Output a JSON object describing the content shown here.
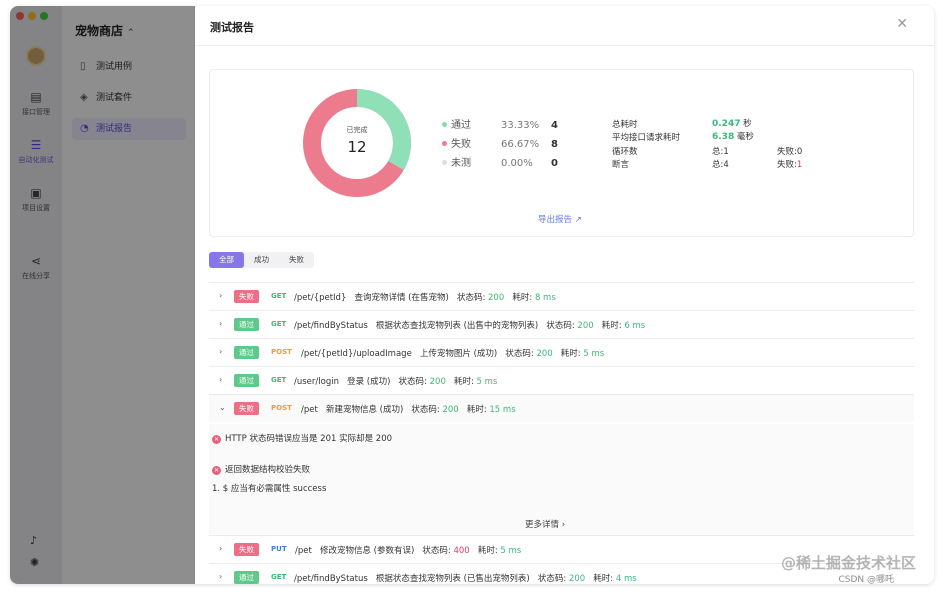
{
  "sidebar": {
    "items": [
      {
        "label": "接口管理",
        "icon": "api-icon"
      },
      {
        "label": "自动化测试",
        "icon": "stack-icon",
        "active": true
      },
      {
        "label": "项目设置",
        "icon": "settings-icon"
      },
      {
        "label": "在线分享",
        "icon": "share-icon"
      }
    ]
  },
  "project": {
    "title": "宠物商店",
    "nav": [
      {
        "label": "测试用例",
        "icon": "file-icon"
      },
      {
        "label": "测试套件",
        "icon": "suite-icon"
      },
      {
        "label": "测试报告",
        "icon": "report-icon",
        "active": true
      }
    ]
  },
  "modal": {
    "title": "测试报告",
    "close": "✕"
  },
  "summary": {
    "center_label": "已完成",
    "center_value": "12",
    "legend": [
      {
        "name": "通过",
        "pct": "33.33%",
        "count": "4",
        "color": "#7edcae"
      },
      {
        "name": "失败",
        "pct": "66.67%",
        "count": "8",
        "color": "#ec7b8e"
      },
      {
        "name": "未测",
        "pct": "0.00%",
        "count": "0",
        "color": "#dddddd"
      }
    ],
    "stats": {
      "total_time_label": "总耗时",
      "total_time_value": "0.247",
      "total_time_unit": "秒",
      "avg_label": "平均接口请求耗时",
      "avg_value": "6.38",
      "avg_unit": "毫秒",
      "loop_label": "循环数",
      "loop_total": "总:1",
      "loop_fail": "失败:0",
      "assert_label": "断言",
      "assert_total": "总:4",
      "assert_fail_prefix": "失败:",
      "assert_fail_value": "1"
    },
    "export": "导出报告 ↗",
    "donut": {
      "pass": 4,
      "fail": 8,
      "untested": 0,
      "pass_color": "#8fe0b6",
      "fail_color": "#ec7b8e"
    }
  },
  "filters": [
    "全部",
    "成功",
    "失败"
  ],
  "rows": [
    {
      "status": "失败",
      "method": "GET",
      "path": "/pet/{petId}",
      "desc": "查询宠物详情 (在售宠物)",
      "code_label": "状态码:",
      "code": "200",
      "time_label": "耗时:",
      "time": "8 ms"
    },
    {
      "status": "通过",
      "method": "GET",
      "path": "/pet/findByStatus",
      "desc": "根据状态查找宠物列表 (出售中的宠物列表)",
      "code_label": "状态码:",
      "code": "200",
      "time_label": "耗时:",
      "time": "6 ms"
    },
    {
      "status": "通过",
      "method": "POST",
      "path": "/pet/{petId}/uploadImage",
      "desc": "上传宠物图片 (成功)",
      "code_label": "状态码:",
      "code": "200",
      "time_label": "耗时:",
      "time": "5 ms"
    },
    {
      "status": "通过",
      "method": "GET",
      "path": "/user/login",
      "desc": "登录 (成功)",
      "code_label": "状态码:",
      "code": "200",
      "time_label": "耗时:",
      "time": "5 ms"
    },
    {
      "status": "失败",
      "method": "POST",
      "path": "/pet",
      "desc": "新建宠物信息 (成功)",
      "code_label": "状态码:",
      "code": "200",
      "time_label": "耗时:",
      "time": "15 ms"
    },
    {
      "status": "失败",
      "method": "PUT",
      "path": "/pet",
      "desc": "修改宠物信息 (参数有误)",
      "code_label": "状态码:",
      "code": "400",
      "time_label": "耗时:",
      "time": "5 ms"
    },
    {
      "status": "通过",
      "method": "GET",
      "path": "/pet/findByStatus",
      "desc": "根据状态查找宠物列表 (已售出宠物列表)",
      "code_label": "状态码:",
      "code": "200",
      "time_label": "耗时:",
      "time": "4 ms"
    }
  ],
  "expanded": {
    "error1": "HTTP 状态码错误应当是 201 实际却是 200",
    "error2": "返回数据结构校验失败",
    "detail": "1. $ 应当有必需属性 success",
    "more": "更多详情 ›"
  },
  "watermark": {
    "main": "@稀土掘金技术社区",
    "sub": "CSDN @哪吒"
  }
}
